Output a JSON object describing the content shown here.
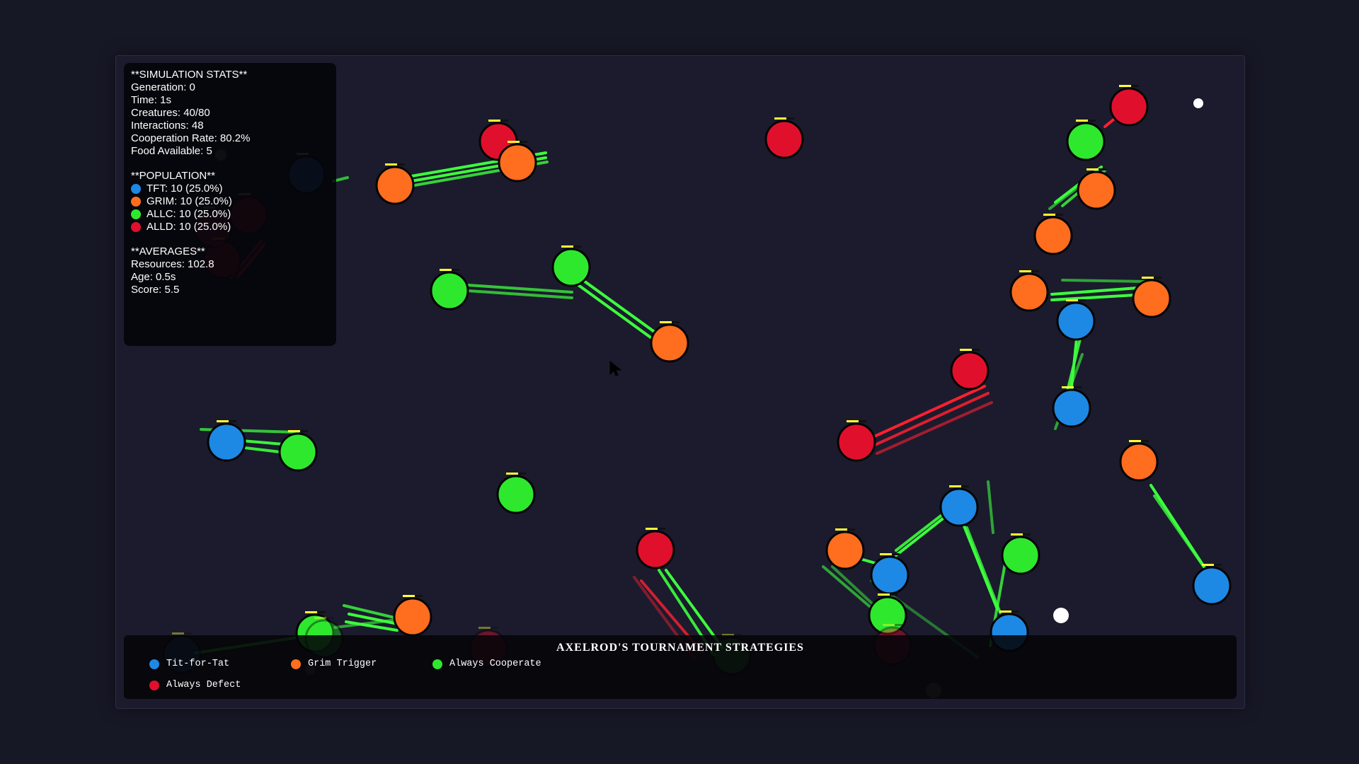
{
  "colors": {
    "background": "#171826",
    "canvas": "#1b1b2d",
    "tft": "#1e88e5",
    "grim": "#ff6d1f",
    "allc": "#2ee82e",
    "alld": "#e0102d",
    "cooperate_link": "#3dff3d",
    "defect_link": "#ff2030",
    "health_bar": "#ffff33",
    "food": "#ffffff"
  },
  "stats": {
    "title": "**SIMULATION STATS**",
    "generation": "Generation: 0",
    "time": "Time: 1s",
    "creatures": "Creatures: 40/80",
    "interactions": "Interactions: 48",
    "cooperation_rate": "Cooperation Rate: 80.2%",
    "food": "Food Available: 5"
  },
  "population": {
    "title": "**POPULATION**",
    "items": [
      {
        "label": "TFT: 10 (25.0%)",
        "color": "#1e88e5"
      },
      {
        "label": "GRIM: 10 (25.0%)",
        "color": "#ff6d1f"
      },
      {
        "label": "ALLC: 10 (25.0%)",
        "color": "#2ee82e"
      },
      {
        "label": "ALLD: 10 (25.0%)",
        "color": "#e0102d"
      }
    ]
  },
  "averages": {
    "title": "**AVERAGES**",
    "resources": "Resources: 102.8",
    "age": "Age: 0.5s",
    "score": "Score: 5.5"
  },
  "legend": {
    "title": "AXELROD'S TOURNAMENT STRATEGIES",
    "items": [
      {
        "label": "Tit-for-Tat",
        "color": "#1e88e5"
      },
      {
        "label": "Grim Trigger",
        "color": "#ff6d1f"
      },
      {
        "label": "Always Cooperate",
        "color": "#2ee82e"
      },
      {
        "label": "Always Defect",
        "color": "#e0102d"
      }
    ]
  }
}
